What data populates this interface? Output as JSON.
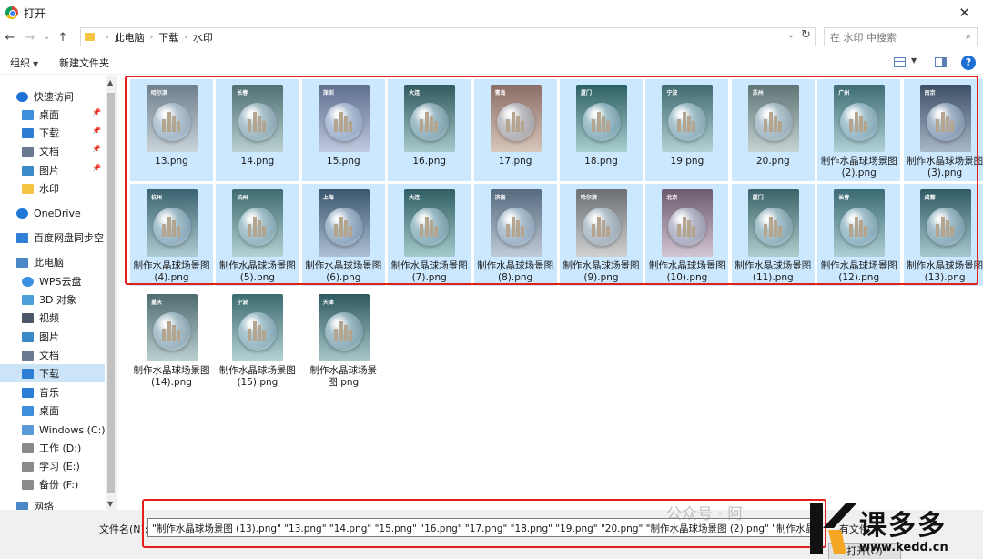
{
  "window": {
    "title": "打开",
    "close": "✕"
  },
  "nav": {
    "back": "←",
    "forward": "→",
    "recent": "⌄",
    "up": "↑",
    "breadcrumbs": [
      "此电脑",
      "下载",
      "水印"
    ],
    "search_placeholder": "在 水印 中搜索"
  },
  "toolbar": {
    "organize": "组织",
    "new_folder": "新建文件夹",
    "help": "?"
  },
  "sidebar": {
    "items": [
      {
        "label": "快速访问",
        "icon": "star-icon",
        "color": "#1d6fd6"
      },
      {
        "label": "桌面",
        "icon": "desktop-icon",
        "color": "#3d8fd9",
        "pinned": true
      },
      {
        "label": "下载",
        "icon": "download-icon",
        "color": "#2d7fd6",
        "pinned": true
      },
      {
        "label": "文档",
        "icon": "document-icon",
        "color": "#6b7a8f",
        "pinned": true
      },
      {
        "label": "图片",
        "icon": "picture-icon",
        "color": "#3b8ac8",
        "pinned": true
      },
      {
        "label": "水印",
        "icon": "folder-icon",
        "color": "#f4c542"
      },
      {
        "label": "OneDrive",
        "icon": "cloud-icon",
        "color": "#1d77d6"
      },
      {
        "label": "百度网盘同步空间",
        "icon": "baidu-icon",
        "color": "#2f7fd6"
      },
      {
        "label": "此电脑",
        "icon": "computer-icon",
        "color": "#4b86c6"
      },
      {
        "label": "WPS云盘",
        "icon": "cloud-icon",
        "color": "#3b8fe0"
      },
      {
        "label": "3D 对象",
        "icon": "cube-icon",
        "color": "#4aa0d8"
      },
      {
        "label": "视频",
        "icon": "video-icon",
        "color": "#4a5868"
      },
      {
        "label": "图片",
        "icon": "picture-icon",
        "color": "#3b8ac8"
      },
      {
        "label": "文档",
        "icon": "document-icon",
        "color": "#6b7a8f"
      },
      {
        "label": "下载",
        "icon": "download-icon",
        "color": "#2d7fd6"
      },
      {
        "label": "音乐",
        "icon": "music-icon",
        "color": "#2d7fd6"
      },
      {
        "label": "桌面",
        "icon": "desktop-icon",
        "color": "#3d8fd9"
      },
      {
        "label": "Windows  (C:)",
        "icon": "drive-icon",
        "color": "#5a9ad6"
      },
      {
        "label": "工作 (D:)",
        "icon": "drive-icon",
        "color": "#8a8a8a"
      },
      {
        "label": "学习 (E:)",
        "icon": "drive-icon",
        "color": "#8a8a8a"
      },
      {
        "label": "备份 (F:)",
        "icon": "drive-icon",
        "color": "#8a8a8a"
      },
      {
        "label": "网络",
        "icon": "network-icon",
        "color": "#4b86c6"
      }
    ]
  },
  "files": [
    {
      "name": "13.png",
      "city": "哈尔滨",
      "bg": [
        "#6f7f8c",
        "#c9d3da"
      ],
      "selected": true
    },
    {
      "name": "14.png",
      "city": "长春",
      "bg": [
        "#4f6f73",
        "#b9d0d0"
      ],
      "selected": true
    },
    {
      "name": "15.png",
      "city": "深圳",
      "bg": [
        "#5e6f8e",
        "#c0c9de"
      ],
      "selected": true
    },
    {
      "name": "16.png",
      "city": "大连",
      "bg": [
        "#2f5a5e",
        "#a8c9cb"
      ],
      "selected": true
    },
    {
      "name": "17.png",
      "city": "青岛",
      "bg": [
        "#8a6e66",
        "#d8c6bb"
      ],
      "selected": true
    },
    {
      "name": "18.png",
      "city": "厦门",
      "bg": [
        "#2d5f62",
        "#a9cfd0"
      ],
      "selected": true
    },
    {
      "name": "19.png",
      "city": "宁波",
      "bg": [
        "#3f6a70",
        "#b3d2d3"
      ],
      "selected": true
    },
    {
      "name": "20.png",
      "city": "苏州",
      "bg": [
        "#5f7476",
        "#c6d3d2"
      ],
      "selected": true
    },
    {
      "name": "制作水晶球场景图 (2).png",
      "city": "广州",
      "bg": [
        "#3d6c74",
        "#b0d1d6"
      ],
      "selected": true
    },
    {
      "name": "制作水晶球场景图 (3).png",
      "city": "南京",
      "bg": [
        "#3d4f66",
        "#aab6c9"
      ],
      "selected": true
    },
    {
      "name": "制作水晶球场景图 (4).png",
      "city": "杭州",
      "bg": [
        "#3a6470",
        "#afcad2"
      ],
      "selected": true
    },
    {
      "name": "制作水晶球场景图 (5).png",
      "city": "杭州",
      "bg": [
        "#3e6b6f",
        "#b4d2d3"
      ],
      "selected": true
    },
    {
      "name": "制作水晶球场景图 (6).png",
      "city": "上海",
      "bg": [
        "#3a566e",
        "#adc0d3"
      ],
      "selected": true
    },
    {
      "name": "制作水晶球场景图 (7).png",
      "city": "大连",
      "bg": [
        "#2f5e63",
        "#a5cbcc"
      ],
      "selected": true
    },
    {
      "name": "制作水晶球场景图 (8).png",
      "city": "济南",
      "bg": [
        "#566a7e",
        "#c0cbd8"
      ],
      "selected": true
    },
    {
      "name": "制作水晶球场景图 (9).png",
      "city": "哈尔滨",
      "bg": [
        "#6c6f73",
        "#cfd0d1"
      ],
      "selected": true
    },
    {
      "name": "制作水晶球场景图 (10).png",
      "city": "北京",
      "bg": [
        "#6d5a6e",
        "#d2c5d2"
      ],
      "selected": true
    },
    {
      "name": "制作水晶球场景图 (11).png",
      "city": "厦门",
      "bg": [
        "#3b6468",
        "#b0cdce"
      ],
      "selected": true
    },
    {
      "name": "制作水晶球场景图 (12).png",
      "city": "长春",
      "bg": [
        "#3a6a73",
        "#aecfd4"
      ],
      "selected": true
    },
    {
      "name": "制作水晶球场景图 (13).png",
      "city": "成都",
      "bg": [
        "#2f5a64",
        "#a6c7ce"
      ],
      "selected": true
    },
    {
      "name": "制作水晶球场景图 (14).png",
      "city": "重庆",
      "bg": [
        "#4f6c70",
        "#bcd0d1"
      ],
      "selected": false
    },
    {
      "name": "制作水晶球场景图 (15).png",
      "city": "宁波",
      "bg": [
        "#3c6b70",
        "#b5d3d5"
      ],
      "selected": false
    },
    {
      "name": "制作水晶球场景图.png",
      "city": "天津",
      "bg": [
        "#2f5a60",
        "#a8c8ca"
      ],
      "selected": false
    }
  ],
  "bottom": {
    "filename_label": "文件名(N):",
    "filename_value": "\"制作水晶球场景图 (13).png\" \"13.png\" \"14.png\" \"15.png\" \"16.png\" \"17.png\" \"18.png\" \"19.png\" \"20.png\" \"制作水晶球场景图 (2).png\" \"制作水晶球场景",
    "filter_label": "有文件",
    "open_button": "打开(O)"
  },
  "watermark": {
    "text": "公众号 · 阿",
    "brand": "课多多",
    "url": "www.kedd.cn"
  },
  "colors": {
    "selection": "#cce8ff",
    "highlight": "#e0201c",
    "accent": "#1d6fd6"
  }
}
